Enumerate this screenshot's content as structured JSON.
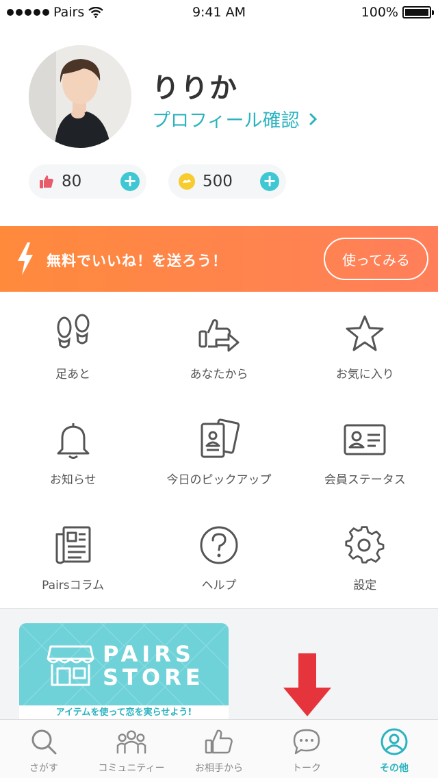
{
  "status_bar": {
    "carrier": "Pairs",
    "time": "9:41 AM",
    "battery": "100%"
  },
  "profile": {
    "name": "りりか",
    "profile_link": "プロフィール確認",
    "likes": "80",
    "coins": "500"
  },
  "promo": {
    "text": "無料でいいね！を送ろう！",
    "button": "使ってみる",
    "colors": {
      "start": "#ff8a3c",
      "end": "#ff7f5a"
    }
  },
  "menu": {
    "items": [
      {
        "label": "足あと",
        "icon": "footprints-icon"
      },
      {
        "label": "あなたから",
        "icon": "thumbs-up-send-icon"
      },
      {
        "label": "お気に入り",
        "icon": "star-icon"
      },
      {
        "label": "お知らせ",
        "icon": "bell-icon"
      },
      {
        "label": "今日のピックアップ",
        "icon": "pickup-cards-icon"
      },
      {
        "label": "会員ステータス",
        "icon": "id-card-icon"
      },
      {
        "label": "Pairsコラム",
        "icon": "newspaper-icon"
      },
      {
        "label": "ヘルプ",
        "icon": "help-icon"
      },
      {
        "label": "設定",
        "icon": "gear-icon"
      }
    ]
  },
  "store": {
    "title_line1": "PAIRS",
    "title_line2": "STORE",
    "subtitle": "アイテムを使って恋を実らせよう!"
  },
  "tabs": [
    {
      "label": "さがす",
      "icon": "search-icon"
    },
    {
      "label": "コミュニティー",
      "icon": "community-icon"
    },
    {
      "label": "お相手から",
      "icon": "thumbs-up-icon"
    },
    {
      "label": "トーク",
      "icon": "chat-icon"
    },
    {
      "label": "その他",
      "icon": "user-icon",
      "active": true
    }
  ],
  "colors": {
    "accent": "#2bb3bf",
    "arrow": "#e5343c"
  }
}
